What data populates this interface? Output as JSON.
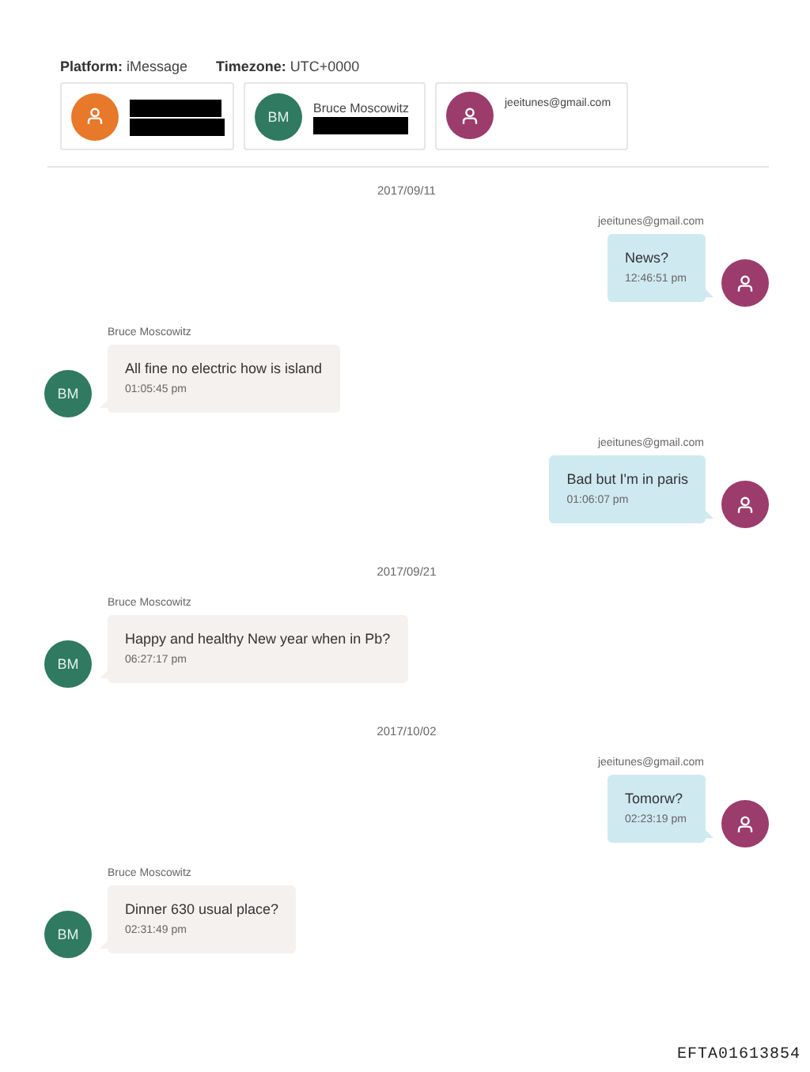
{
  "header": {
    "fields": [
      {
        "label": "Platform:",
        "value": "iMessage"
      },
      {
        "label": "Timezone:",
        "value": "UTC+0000"
      }
    ]
  },
  "participants": [
    {
      "avatar": {
        "kind": "icon",
        "color": "#e8782a"
      },
      "name_redacted": true,
      "detail_redacted": true
    },
    {
      "avatar": {
        "kind": "initials",
        "initials": "BM",
        "color": "#2f7a61"
      },
      "name": "Bruce Moscowitz",
      "detail_redacted": true
    },
    {
      "avatar": {
        "kind": "icon",
        "color": "#9b3c6c"
      },
      "name": "jeeitunes@gmail.com",
      "detail_redacted": false
    }
  ],
  "feed": [
    {
      "kind": "date",
      "text": "2017/09/11"
    },
    {
      "kind": "outgoing",
      "sender": "jeeitunes@gmail.com",
      "text": "News?",
      "time": "12:46:51 pm",
      "avatar": {
        "kind": "icon",
        "color": "#9b3c6c"
      }
    },
    {
      "kind": "incoming",
      "sender": "Bruce Moscowitz",
      "text": "All fine no electric how is island",
      "time": "01:05:45 pm",
      "avatar": {
        "kind": "initials",
        "initials": "BM",
        "color": "#2f7a61"
      }
    },
    {
      "kind": "outgoing",
      "sender": "jeeitunes@gmail.com",
      "text": "Bad but I'm in paris",
      "time": "01:06:07 pm",
      "avatar": {
        "kind": "icon",
        "color": "#9b3c6c"
      }
    },
    {
      "kind": "date",
      "text": "2017/09/21"
    },
    {
      "kind": "incoming",
      "sender": "Bruce Moscowitz",
      "text": "Happy and healthy New year when in Pb?",
      "time": "06:27:17 pm",
      "avatar": {
        "kind": "initials",
        "initials": "BM",
        "color": "#2f7a61"
      }
    },
    {
      "kind": "date",
      "text": "2017/10/02"
    },
    {
      "kind": "outgoing",
      "sender": "jeeitunes@gmail.com",
      "text": "Tomorw?",
      "time": "02:23:19 pm",
      "avatar": {
        "kind": "icon",
        "color": "#9b3c6c"
      }
    },
    {
      "kind": "incoming",
      "sender": "Bruce Moscowitz",
      "text": "Dinner 630 usual place?",
      "time": "02:31:49 pm",
      "avatar": {
        "kind": "initials",
        "initials": "BM",
        "color": "#2f7a61"
      }
    }
  ],
  "footer": {
    "document_id": "EFTA01613854"
  }
}
